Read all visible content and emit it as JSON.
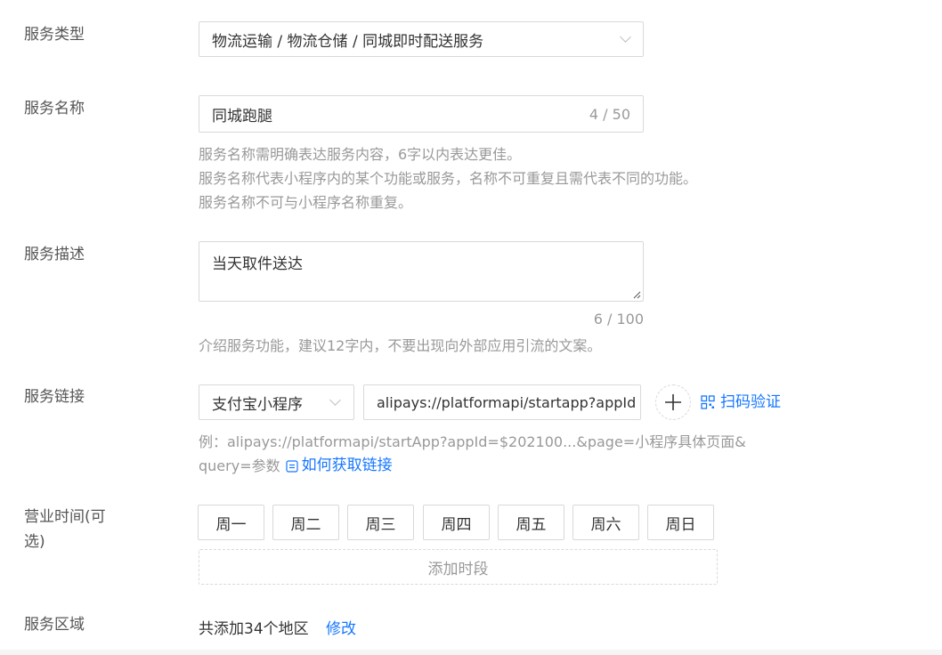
{
  "service_type": {
    "label": "服务类型",
    "value": "物流运输 / 物流仓储 / 同城即时配送服务"
  },
  "service_name": {
    "label": "服务名称",
    "value": "同城跑腿",
    "count": "4 / 50",
    "hints": [
      "服务名称需明确表达服务内容，6字以内表达更佳。",
      "服务名称代表小程序内的某个功能或服务，名称不可重复且需代表不同的功能。",
      "服务名称不可与小程序名称重复。"
    ]
  },
  "service_desc": {
    "label": "服务描述",
    "value": "当天取件送达",
    "count": "6 / 100",
    "hint": "介绍服务功能，建议12字内，不要出现向外部应用引流的文案。"
  },
  "service_link": {
    "label": "服务链接",
    "type_value": "支付宝小程序",
    "url_value": "alipays://platformapi/startapp?appId",
    "scan_label": "扫码验证",
    "example_line1": "例：alipays://platformapi/startApp?appId=$202100...&page=小程序具体页面&",
    "example_line2_prefix": "query=参数",
    "how_to_label": "如何获取链接"
  },
  "business_hours": {
    "label_line1": "营业时间(可",
    "label_line2": "选)",
    "days": [
      "周一",
      "周二",
      "周三",
      "周四",
      "周五",
      "周六",
      "周日"
    ],
    "add_period": "添加时段"
  },
  "service_area": {
    "label": "服务区域",
    "summary": "共添加34个地区",
    "edit_label": "修改"
  },
  "colors": {
    "accent": "#1677ff",
    "border": "#d9d9d9",
    "hint": "#999999"
  }
}
